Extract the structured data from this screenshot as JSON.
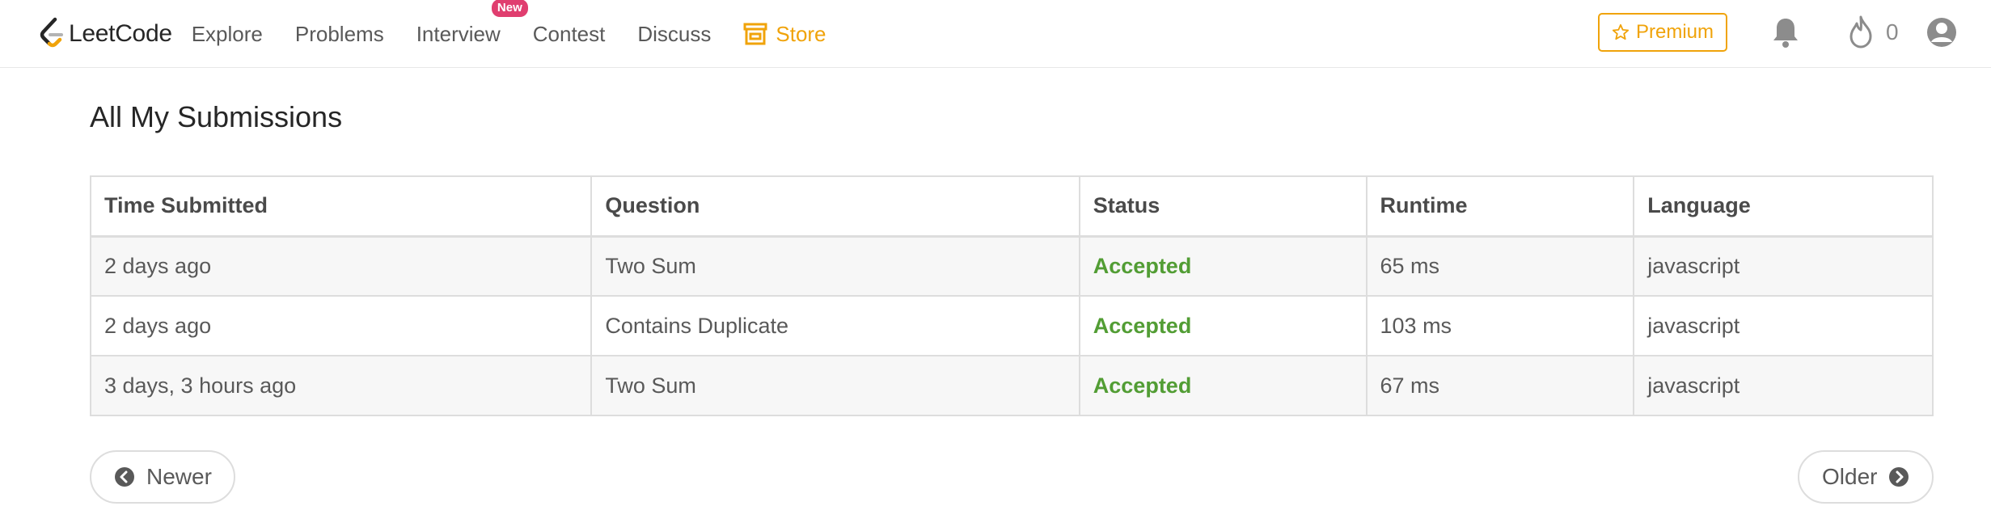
{
  "nav": {
    "logo_text": "LeetCode",
    "items": [
      {
        "label": "Explore"
      },
      {
        "label": "Problems"
      },
      {
        "label": "Interview",
        "badge": "New"
      },
      {
        "label": "Contest"
      },
      {
        "label": "Discuss"
      },
      {
        "label": "Store"
      }
    ],
    "premium_label": "Premium",
    "streak_count": "0",
    "icons": [
      "leetcode-logo-icon",
      "store-icon",
      "star-icon",
      "bell-icon",
      "flame-icon",
      "user-icon"
    ]
  },
  "colors": {
    "accent": "#f0a30a",
    "badge": "#e03e6f",
    "accepted": "#529d34"
  },
  "page": {
    "title": "All My Submissions"
  },
  "table": {
    "headers": [
      "Time Submitted",
      "Question",
      "Status",
      "Runtime",
      "Language"
    ],
    "rows": [
      [
        "2 days ago",
        "Two Sum",
        "Accepted",
        "65 ms",
        "javascript"
      ],
      [
        "2 days ago",
        "Contains Duplicate",
        "Accepted",
        "103 ms",
        "javascript"
      ],
      [
        "3 days, 3 hours ago",
        "Two Sum",
        "Accepted",
        "67 ms",
        "javascript"
      ]
    ]
  },
  "pager": {
    "newer_label": "Newer",
    "older_label": "Older"
  }
}
